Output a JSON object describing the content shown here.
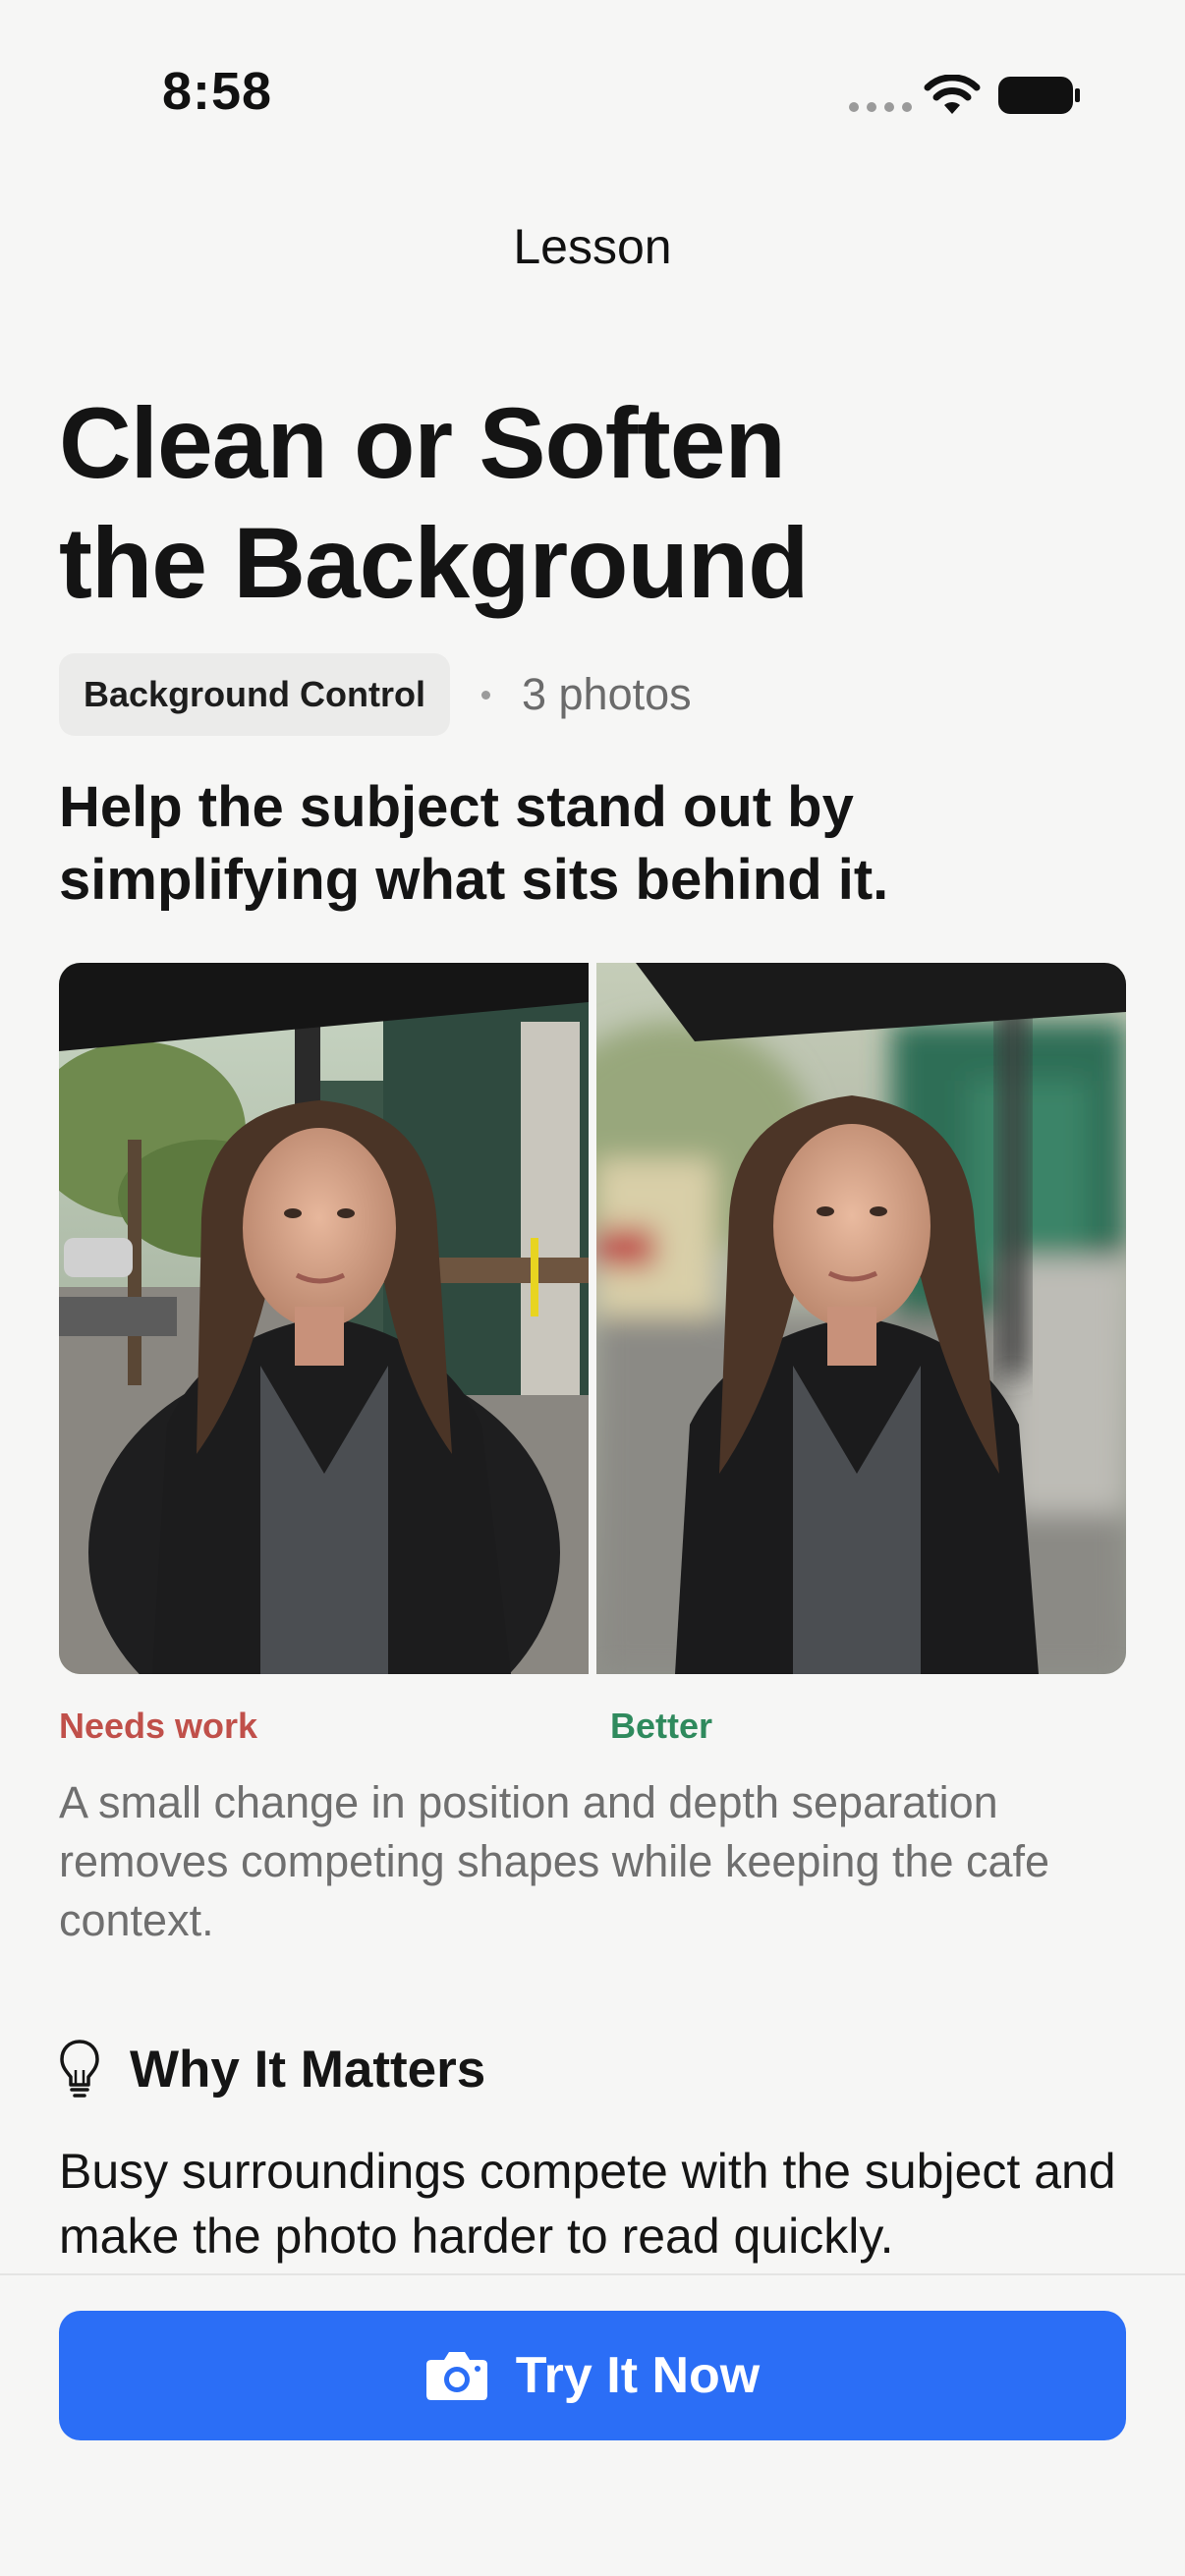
{
  "status_bar": {
    "time": "8:58",
    "icons": [
      "cellular-signal-icon",
      "wifi-icon",
      "battery-icon"
    ]
  },
  "nav": {
    "title": "Lesson"
  },
  "lesson": {
    "title_line1": "Clean or Soften",
    "title_line2": "the Background",
    "category": "Background Control",
    "photo_count": "3 photos",
    "subtitle": "Help the subject stand out by simplifying what sits behind it."
  },
  "comparison": {
    "before_label": "Needs work",
    "after_label": "Better",
    "description": "A small change in position and depth separation removes competing shapes while keeping the cafe context."
  },
  "why_it_matters": {
    "icon": "lightbulb-icon",
    "title": "Why It Matters",
    "body": "Busy surroundings compete with the subject and make the photo harder to read quickly."
  },
  "cta": {
    "label": "Try It Now",
    "icon": "camera-icon"
  },
  "colors": {
    "background": "#f6f6f5",
    "accent": "#2b6ef6",
    "needs_work": "#c0504a",
    "better": "#2f8a5d"
  }
}
